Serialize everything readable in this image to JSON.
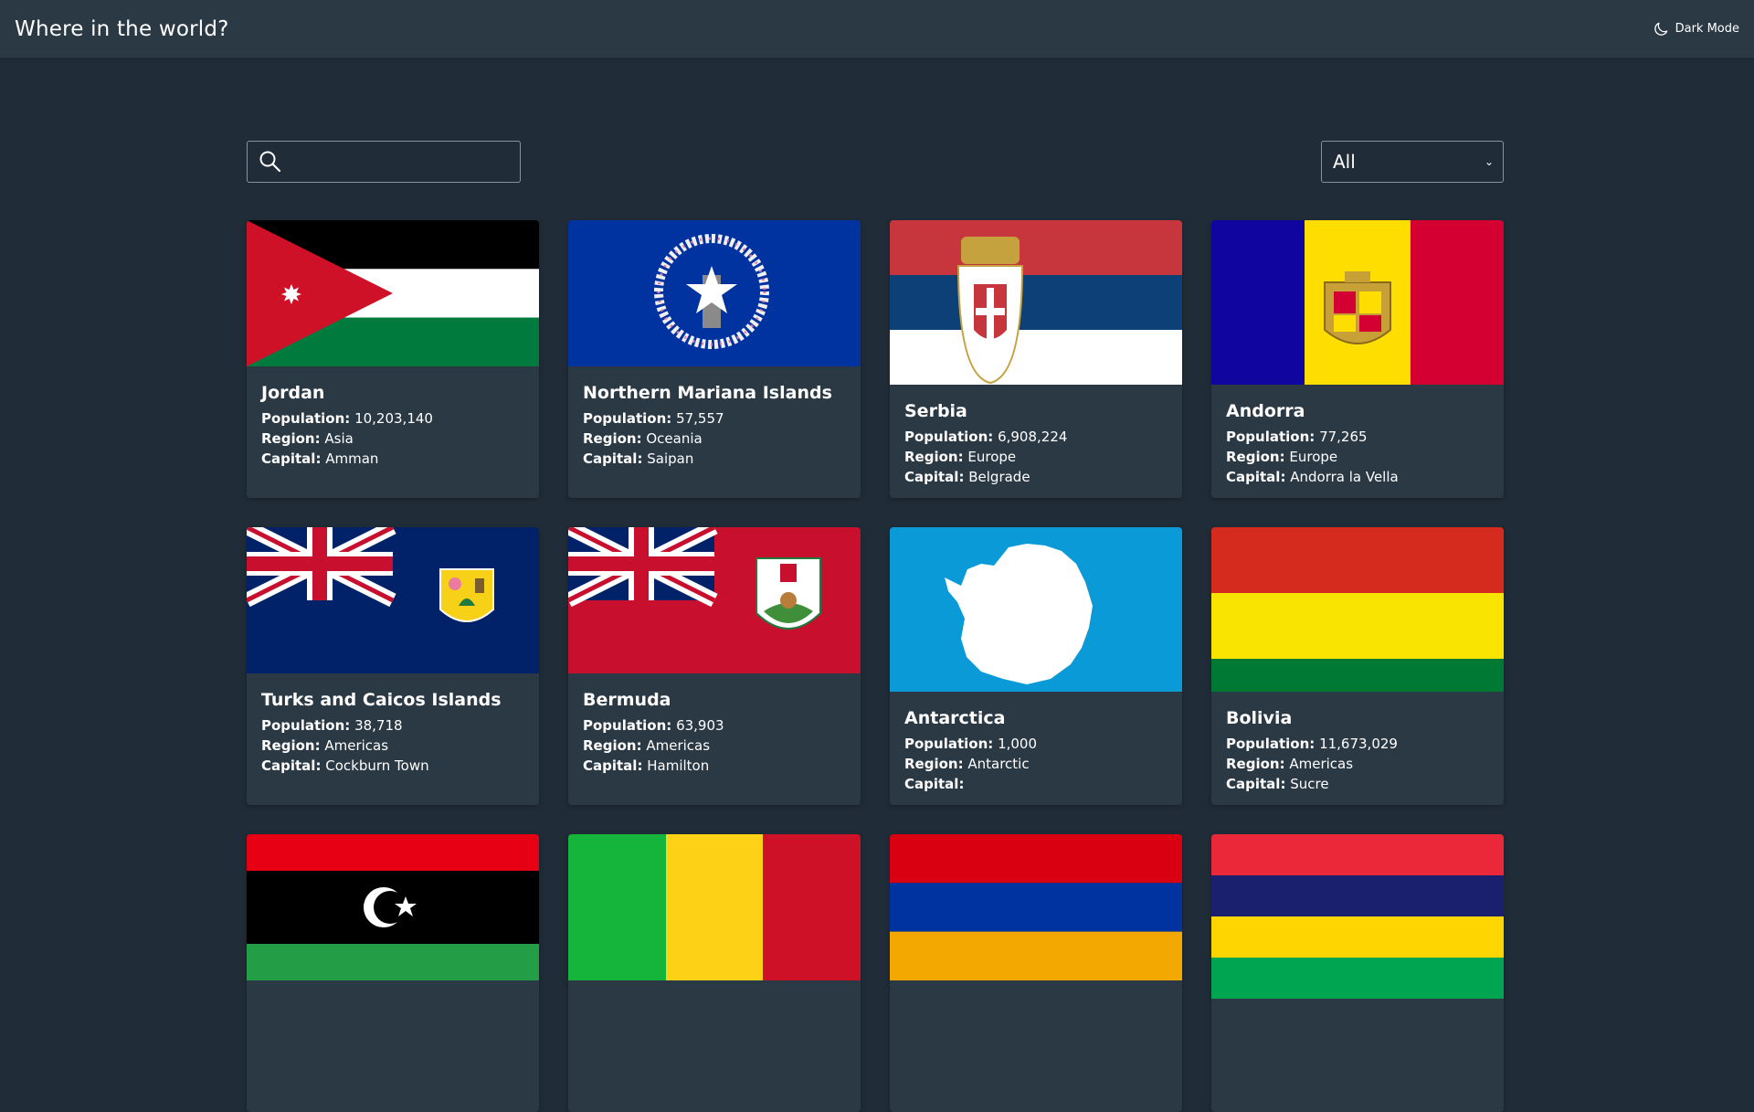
{
  "header": {
    "title": "Where in the world?",
    "theme_toggle_label": "Dark Mode"
  },
  "search": {
    "value": "",
    "placeholder": ""
  },
  "filter": {
    "selected": "All"
  },
  "labels": {
    "population": "Population:",
    "region": "Region:",
    "capital": "Capital:"
  },
  "countries": [
    {
      "name": "Jordan",
      "population": "10,203,140",
      "region": "Asia",
      "capital": "Amman"
    },
    {
      "name": "Northern Mariana Islands",
      "population": "57,557",
      "region": "Oceania",
      "capital": "Saipan"
    },
    {
      "name": "Serbia",
      "population": "6,908,224",
      "region": "Europe",
      "capital": "Belgrade"
    },
    {
      "name": "Andorra",
      "population": "77,265",
      "region": "Europe",
      "capital": "Andorra la Vella"
    },
    {
      "name": "Turks and Caicos Islands",
      "population": "38,718",
      "region": "Americas",
      "capital": "Cockburn Town"
    },
    {
      "name": "Bermuda",
      "population": "63,903",
      "region": "Americas",
      "capital": "Hamilton"
    },
    {
      "name": "Antarctica",
      "population": "1,000",
      "region": "Antarctic",
      "capital": ""
    },
    {
      "name": "Bolivia",
      "population": "11,673,029",
      "region": "Americas",
      "capital": "Sucre"
    }
  ],
  "colors": {
    "background": "#202c37",
    "element": "#2b3945",
    "text": "#ffffff"
  }
}
